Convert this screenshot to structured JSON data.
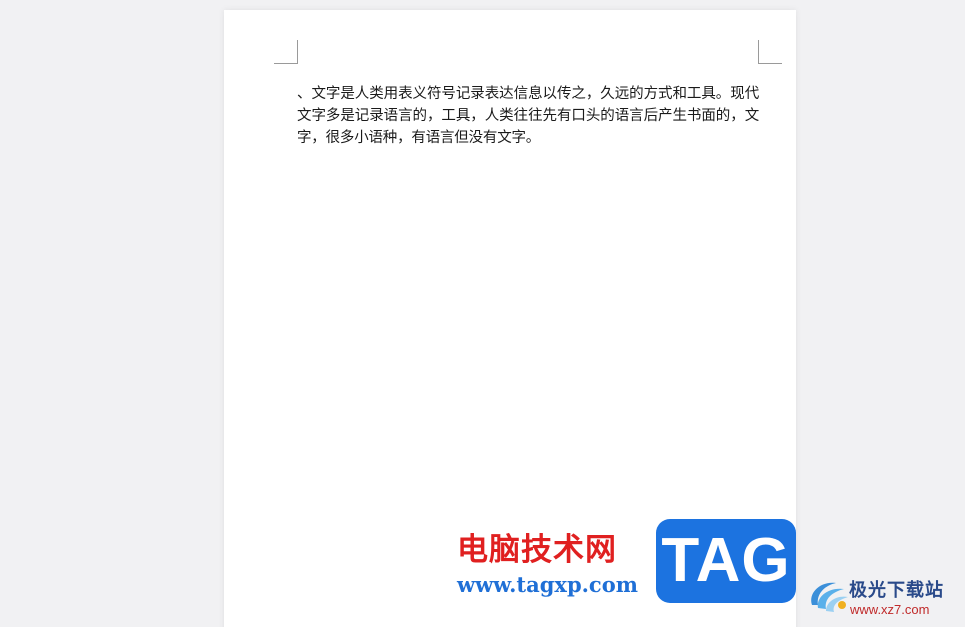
{
  "document": {
    "body_text": "、文字是人类用表义符号记录表达信息以传之，久远的方式和工具。现代文字多是记录语言的，工具，人类往往先有口头的语言后产生书面的，文字，很多小语种，有语言但没有文字。"
  },
  "watermark": {
    "site_name": "电脑技术网",
    "site_url": "www.tagxp.com",
    "tag_badge": "TAG",
    "brand_cn": "极光下载站",
    "brand_url": "www.xz7.com",
    "colors": {
      "site_name": "#e02020",
      "site_url": "#1f6fd6",
      "tag_badge_bg": "#1c73e0",
      "brand_cn": "#2a4a8a",
      "brand_url": "#c02a2a"
    }
  },
  "colors": {
    "workspace_bg": "#f1f1f3",
    "page_bg": "#ffffff",
    "text": "#1a1a1a",
    "margin_marks": "#9a9a9a"
  }
}
